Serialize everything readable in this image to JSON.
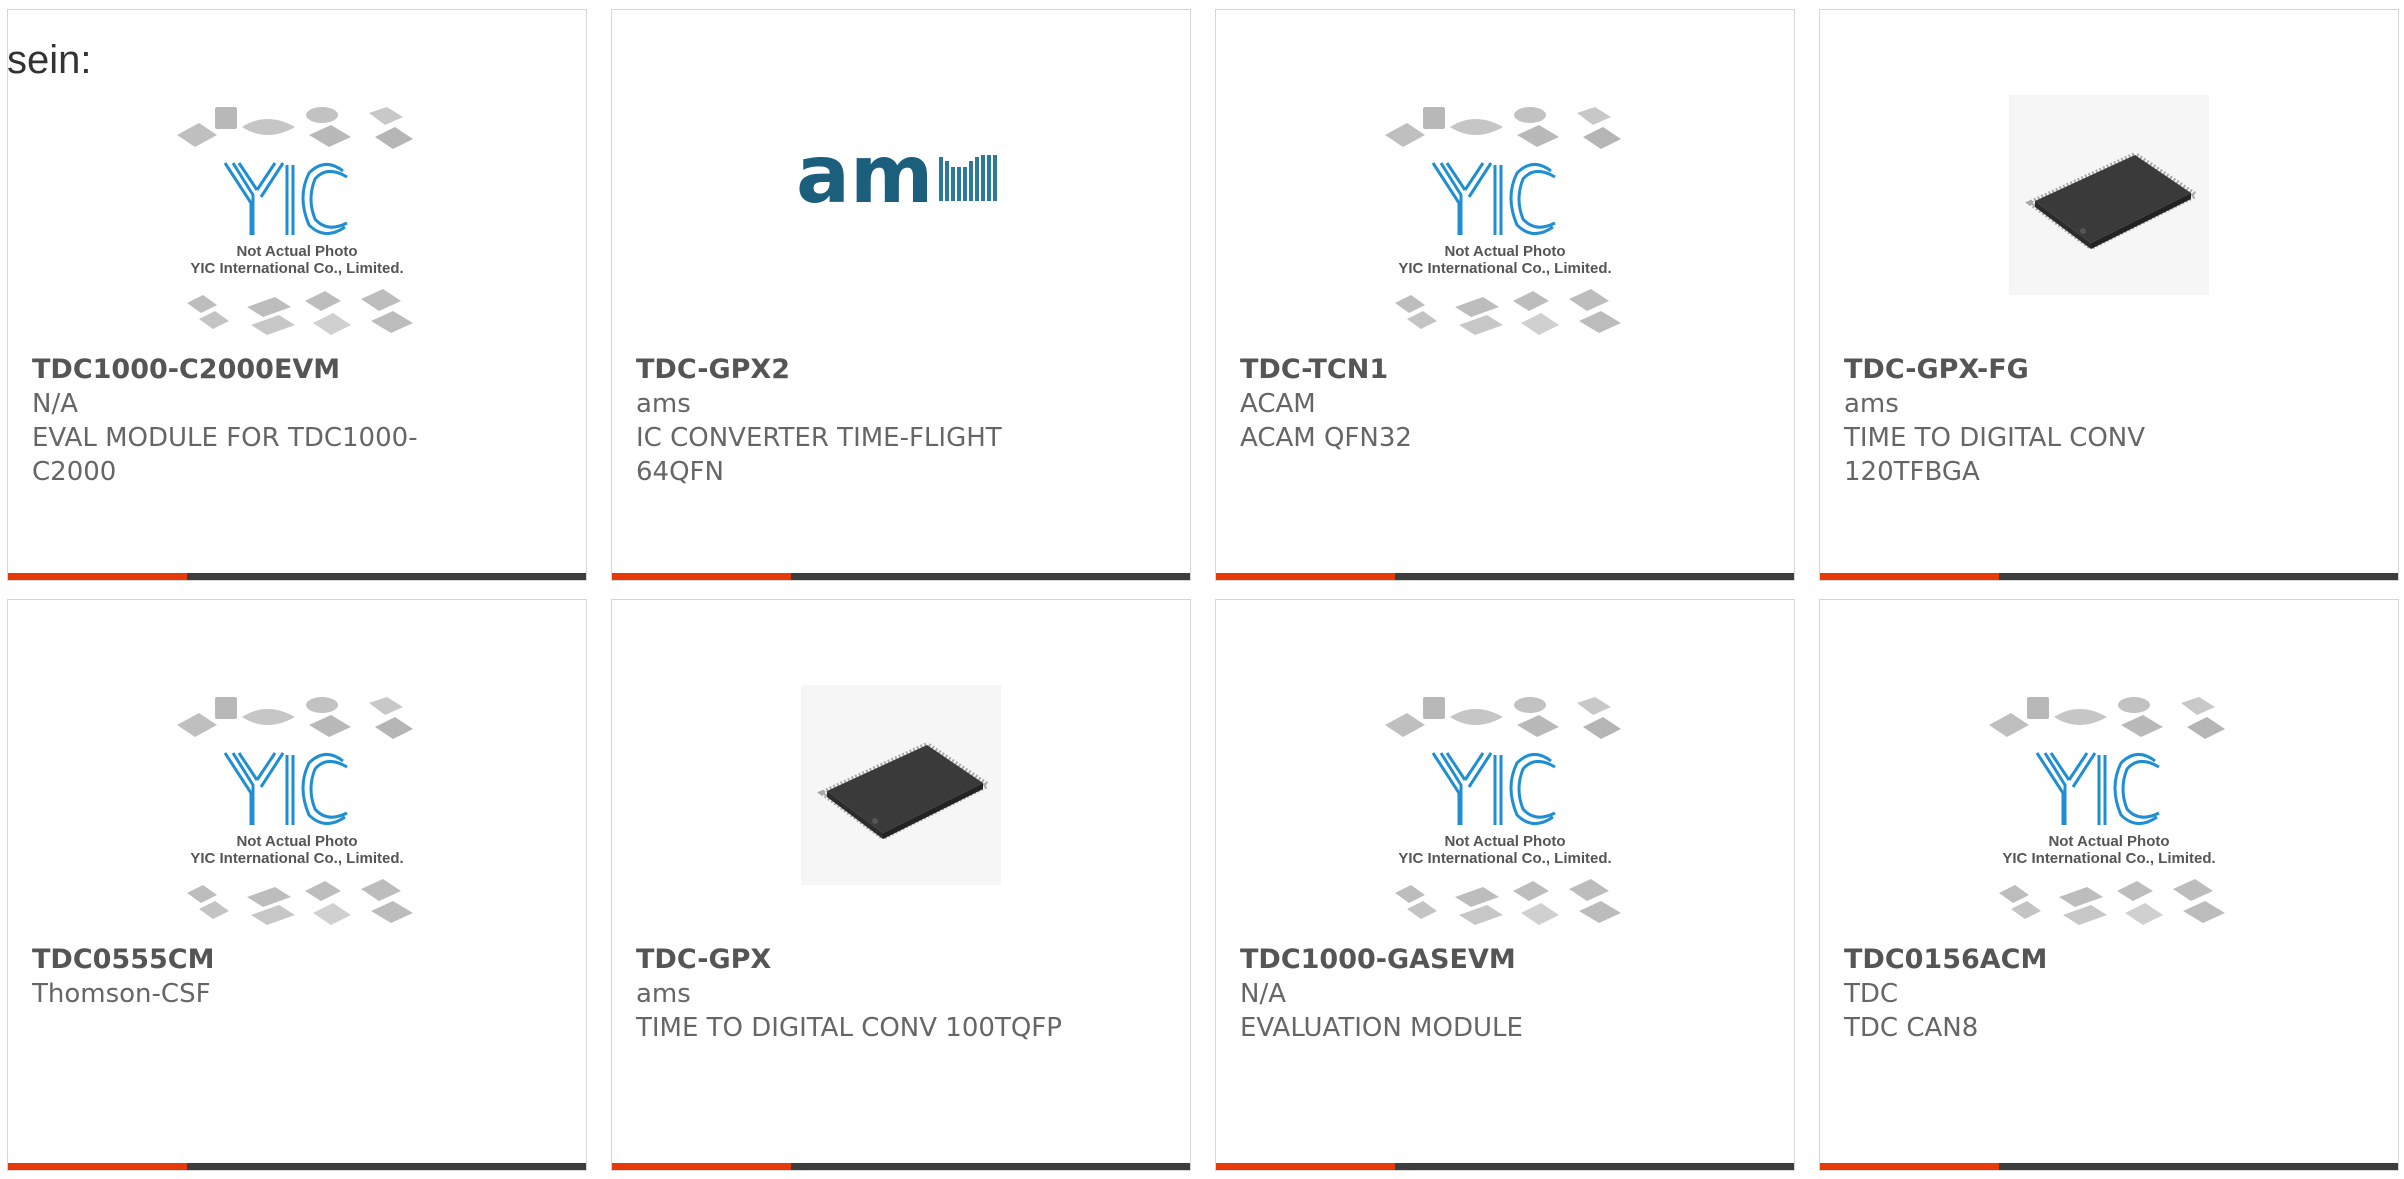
{
  "intro_text": "sein:",
  "placeholder": {
    "caption1": "Not Actual Photo",
    "caption2": "YIC International Co., Limited.",
    "logo": "YIC"
  },
  "ams_logo_text": "am",
  "colors": {
    "accent": "#e63a0a",
    "bar": "#3d3d3d",
    "ams_blue": "#1c5f7d",
    "yic_blue": "#1f8ed2"
  },
  "cards": [
    {
      "image": "yic-placeholder-icon",
      "part": "TDC1000-C2000EVM",
      "mfr": "N/A",
      "desc": "EVAL MODULE FOR TDC1000-C2000"
    },
    {
      "image": "ams-logo-icon",
      "part": "TDC-GPX2",
      "mfr": "ams",
      "desc": "IC CONVERTER TIME-FLIGHT 64QFN"
    },
    {
      "image": "yic-placeholder-icon",
      "part": "TDC-TCN1",
      "mfr": "ACAM",
      "desc": "ACAM QFN32"
    },
    {
      "image": "qfp-chip-icon",
      "part": "TDC-GPX-FG",
      "mfr": "ams",
      "desc": "TIME TO DIGITAL CONV 120TFBGA"
    },
    {
      "image": "yic-placeholder-icon",
      "part": "TDC0555CM",
      "mfr": "Thomson-CSF",
      "desc": ""
    },
    {
      "image": "qfp-chip-icon",
      "part": "TDC-GPX",
      "mfr": "ams",
      "desc": "TIME TO DIGITAL CONV 100TQFP"
    },
    {
      "image": "yic-placeholder-icon",
      "part": "TDC1000-GASEVM",
      "mfr": "N/A",
      "desc": "EVALUATION MODULE"
    },
    {
      "image": "yic-placeholder-icon",
      "part": "TDC0156ACM",
      "mfr": "TDC",
      "desc": "TDC CAN8"
    }
  ]
}
